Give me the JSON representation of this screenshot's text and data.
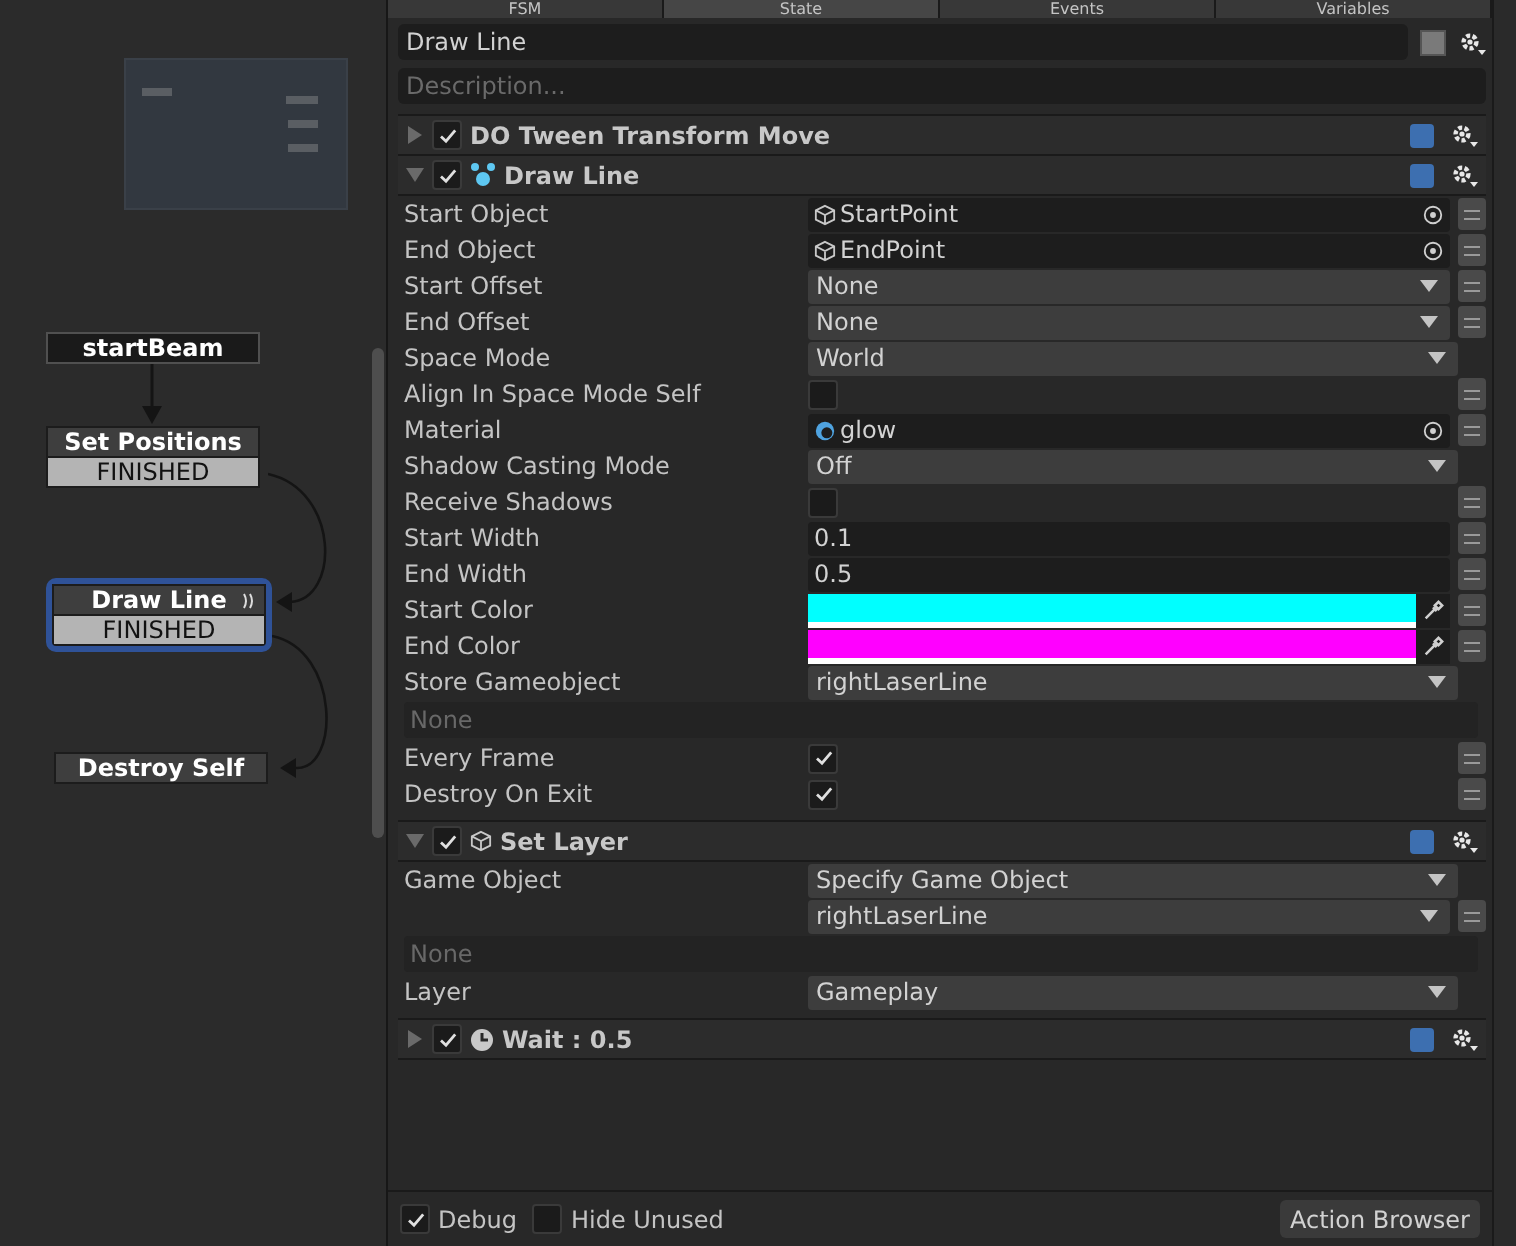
{
  "tabs": [
    {
      "label": "FSM",
      "selected": false
    },
    {
      "label": "State",
      "selected": true
    },
    {
      "label": "Events",
      "selected": false
    },
    {
      "label": "Variables",
      "selected": false
    }
  ],
  "graph": {
    "nodes": [
      {
        "kind": "event",
        "title": "startBeam",
        "selected": false
      },
      {
        "kind": "state",
        "title": "Set Positions",
        "transition": "FINISHED",
        "selected": false,
        "running": false
      },
      {
        "kind": "state",
        "title": "Draw Line",
        "transition": "FINISHED",
        "selected": true,
        "running": true
      },
      {
        "kind": "state",
        "title": "Destroy Self",
        "selected": false,
        "running": false
      }
    ]
  },
  "state": {
    "name": "Draw Line",
    "description_placeholder": "Description..."
  },
  "actions": [
    {
      "title": "DO Tween Transform Move",
      "kind": "tween",
      "enabled": true,
      "expanded": false
    },
    {
      "title": "Draw Line",
      "kind": "line",
      "enabled": true,
      "expanded": true,
      "params": [
        {
          "kind": "gameobject",
          "label": "Start Object",
          "value": "StartPoint",
          "menu": true
        },
        {
          "kind": "gameobject",
          "label": "End Object",
          "value": "EndPoint",
          "menu": true
        },
        {
          "kind": "dropdown",
          "label": "Start Offset",
          "value": "None",
          "menu": true
        },
        {
          "kind": "dropdown",
          "label": "End Offset",
          "value": "None",
          "menu": true
        },
        {
          "kind": "dropdown",
          "label": "Space Mode",
          "value": "World",
          "menu": false
        },
        {
          "kind": "checkbox",
          "label": "Align In Space Mode Self",
          "checked": false,
          "menu": true
        },
        {
          "kind": "material",
          "label": "Material",
          "value": "glow",
          "menu": true
        },
        {
          "kind": "dropdown",
          "label": "Shadow Casting Mode",
          "value": "Off",
          "menu": false
        },
        {
          "kind": "checkbox",
          "label": "Receive Shadows",
          "checked": false,
          "menu": true
        },
        {
          "kind": "number",
          "label": "Start Width",
          "value": "0.1",
          "menu": true
        },
        {
          "kind": "number",
          "label": "End Width",
          "value": "0.5",
          "menu": true
        },
        {
          "kind": "color",
          "label": "Start Color",
          "color": "#00ffff",
          "menu": true
        },
        {
          "kind": "color",
          "label": "End Color",
          "color": "#ff00ff",
          "menu": true
        },
        {
          "kind": "dropdown",
          "label": "Store Gameobject",
          "value": "rightLaserLine",
          "menu": false
        },
        {
          "kind": "field",
          "placeholder": "None"
        },
        {
          "kind": "checkbox",
          "label": "Every Frame",
          "checked": true,
          "menu": true
        },
        {
          "kind": "checkbox",
          "label": "Destroy On Exit",
          "checked": true,
          "menu": true
        }
      ]
    },
    {
      "title": "Set Layer",
      "kind": "layer",
      "enabled": true,
      "expanded": true,
      "params": [
        {
          "kind": "dropdown",
          "label": "Game Object",
          "value": "Specify Game Object",
          "menu": false
        },
        {
          "kind": "dropdown",
          "value": "rightLaserLine",
          "menu": true
        },
        {
          "kind": "field",
          "placeholder": "None"
        },
        {
          "kind": "dropdown",
          "label": "Layer",
          "value": "Gameplay",
          "menu": false
        }
      ]
    },
    {
      "title": "Wait : 0.5",
      "kind": "wait",
      "enabled": true,
      "expanded": false
    }
  ],
  "footer": {
    "debug": {
      "label": "Debug",
      "checked": true
    },
    "hide_unused": {
      "label": "Hide Unused",
      "checked": false
    },
    "button": "Action Browser"
  }
}
